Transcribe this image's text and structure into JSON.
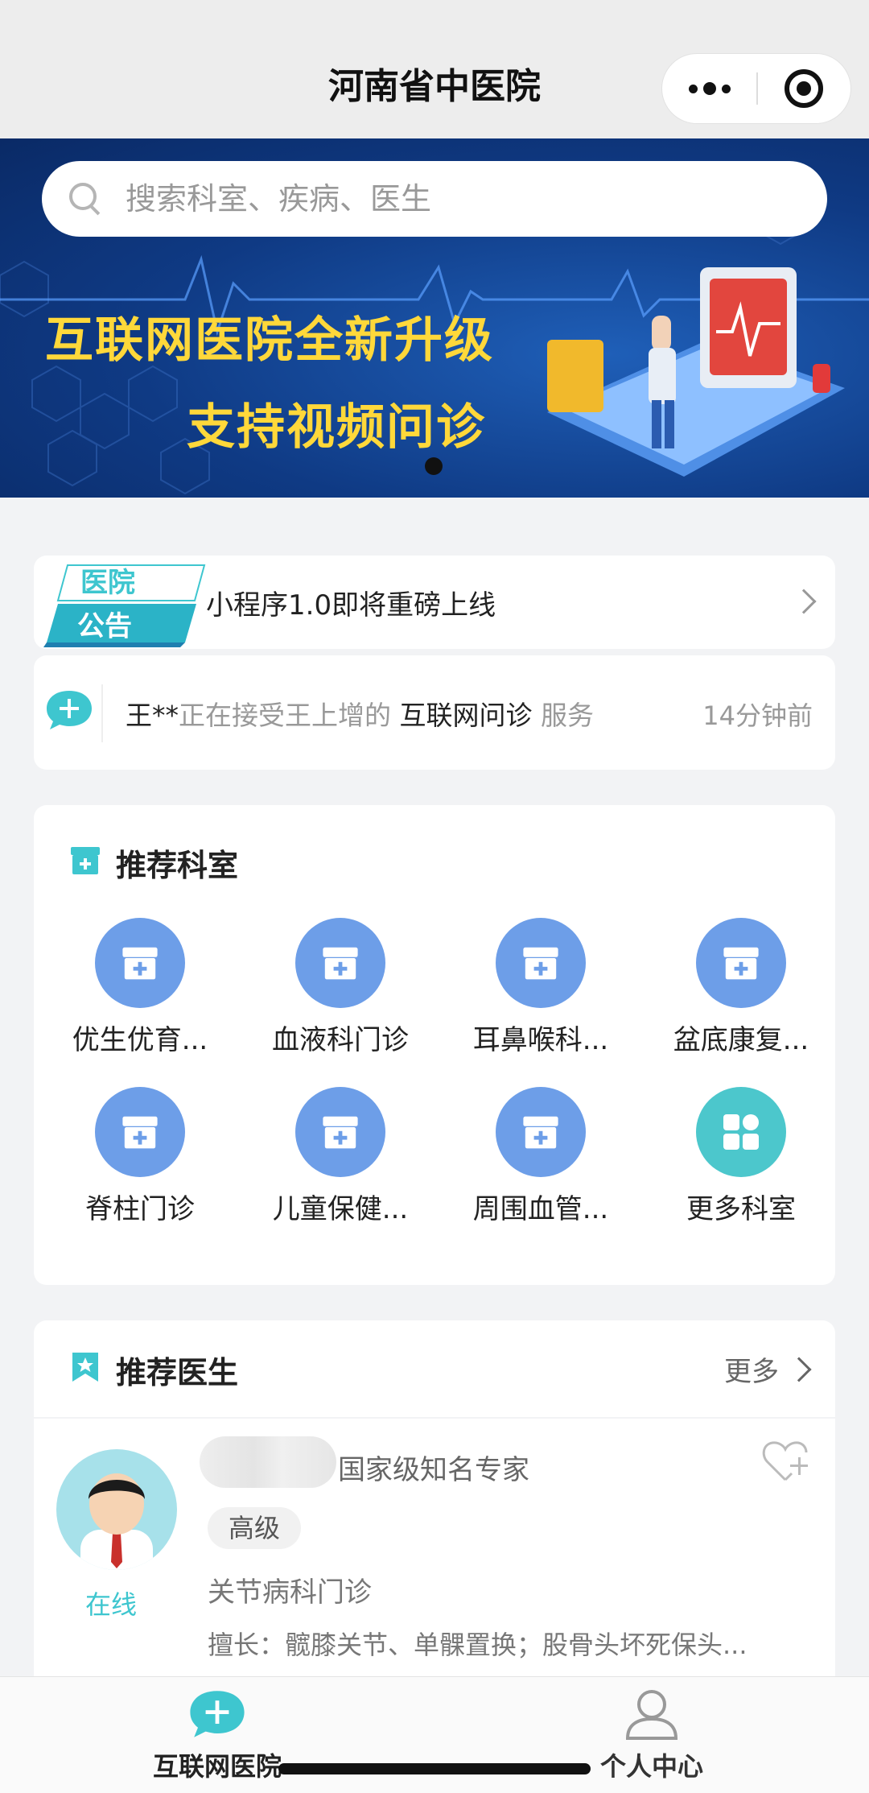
{
  "header": {
    "title": "河南省中医院"
  },
  "search": {
    "placeholder": "搜索科室、疾病、医生"
  },
  "banner": {
    "line1": "互联网医院全新升级",
    "line2": "支持视频问诊"
  },
  "notice": {
    "badge_top": "医院",
    "badge_bottom": "公告",
    "text": "小程序1.0即将重磅上线"
  },
  "activity": {
    "user": "王**",
    "middle": "正在接受王上增的",
    "service": "互联网问诊",
    "suffix": "服务",
    "time": "14分钟前"
  },
  "departments": {
    "title": "推荐科室",
    "items": [
      {
        "label": "优生优育...",
        "icon": "clinic-icon"
      },
      {
        "label": "血液科门诊",
        "icon": "clinic-icon"
      },
      {
        "label": "耳鼻喉科...",
        "icon": "clinic-icon"
      },
      {
        "label": "盆底康复...",
        "icon": "clinic-icon"
      },
      {
        "label": "脊柱门诊",
        "icon": "clinic-icon"
      },
      {
        "label": "儿童保健...",
        "icon": "clinic-icon"
      },
      {
        "label": "周围血管...",
        "icon": "clinic-icon"
      },
      {
        "label": "更多科室",
        "icon": "grid-icon"
      }
    ]
  },
  "doctors": {
    "title": "推荐医生",
    "more": "更多",
    "list": [
      {
        "title": "国家级知名专家",
        "level": "高级",
        "department": "关节病科门诊",
        "skill": "擅长：髋膝关节、单髁置换；股骨头坏死保头...",
        "status": "在线"
      }
    ]
  },
  "tabbar": {
    "items": [
      {
        "label": "互联网医院"
      },
      {
        "label": "个人中心"
      }
    ]
  },
  "colors": {
    "accent": "#3ec6cf",
    "dept_blue": "#6d9ee8",
    "banner_text": "#ffd83a"
  }
}
